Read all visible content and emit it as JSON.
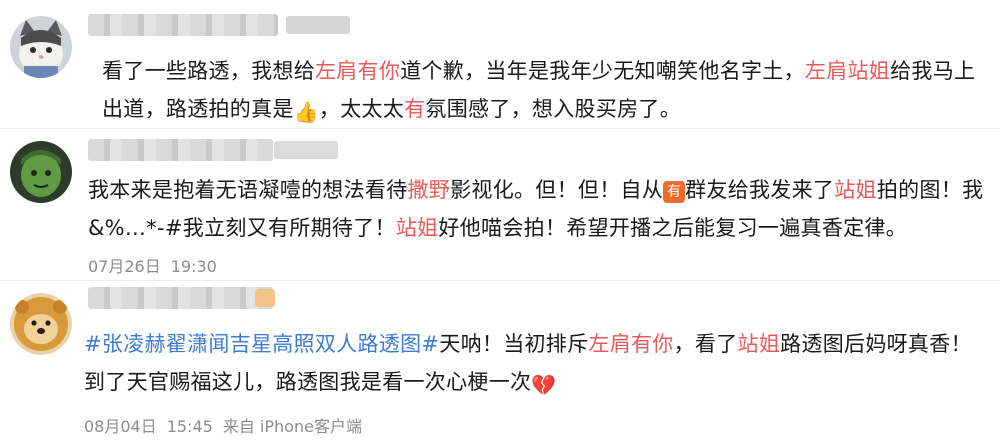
{
  "comments": [
    {
      "avatar_icon": "cat-avatar-icon",
      "segments": [
        {
          "text": "看了一些路透，我想给",
          "style": "normal"
        },
        {
          "text": "左肩有你",
          "style": "red"
        },
        {
          "text": "道个歉，当年是我年少无知嘲笑他名字土，",
          "style": "normal"
        },
        {
          "text": "左肩站姐",
          "style": "red"
        },
        {
          "text": "给我马上出道，路透拍的真是",
          "style": "normal"
        },
        {
          "text": "👍",
          "style": "emoji",
          "icon": "thumbs-up-icon"
        },
        {
          "text": "，太太太",
          "style": "normal"
        },
        {
          "text": "有",
          "style": "red"
        },
        {
          "text": "氛围感了，想入股买房了。",
          "style": "normal"
        }
      ]
    },
    {
      "avatar_icon": "green-figure-avatar-icon",
      "segments": [
        {
          "text": "我本来是抱着无语凝噎的想法看待",
          "style": "normal"
        },
        {
          "text": "撒野",
          "style": "red"
        },
        {
          "text": "影视化。但！但！自从",
          "style": "normal"
        },
        {
          "text": "有",
          "style": "badge",
          "icon": "have-badge-icon"
        },
        {
          "text": "群友给我发来了",
          "style": "normal"
        },
        {
          "text": "站姐",
          "style": "red"
        },
        {
          "text": "拍的图！我&%…*-#我立刻又有所期待了！",
          "style": "normal"
        },
        {
          "text": "站姐",
          "style": "red"
        },
        {
          "text": "好他喵会拍！希望开播之后能复习一遍真香定律。",
          "style": "normal"
        }
      ],
      "date": "07月26日",
      "time": "19:30"
    },
    {
      "avatar_icon": "dog-avatar-icon",
      "segments": [
        {
          "text": "#张凌赫翟潇闻吉星高照双人路透图#",
          "style": "topic"
        },
        {
          "text": "天呐！当初排斥",
          "style": "normal"
        },
        {
          "text": "左肩有你",
          "style": "red"
        },
        {
          "text": "，看了",
          "style": "normal"
        },
        {
          "text": "站姐",
          "style": "red"
        },
        {
          "text": "路透图后妈呀真香！到了天官赐福这儿，路透图我是看一次心梗一次",
          "style": "normal"
        },
        {
          "text": "💔",
          "style": "emoji",
          "icon": "broken-heart-icon"
        }
      ],
      "date": "08月04日",
      "time": "15:45",
      "source": "来自 iPhone客户端"
    }
  ],
  "colors": {
    "highlight": "#eb5a5a",
    "topic": "#3f7bd0",
    "meta": "#8c8c8c",
    "badge": "#f06a2a"
  }
}
